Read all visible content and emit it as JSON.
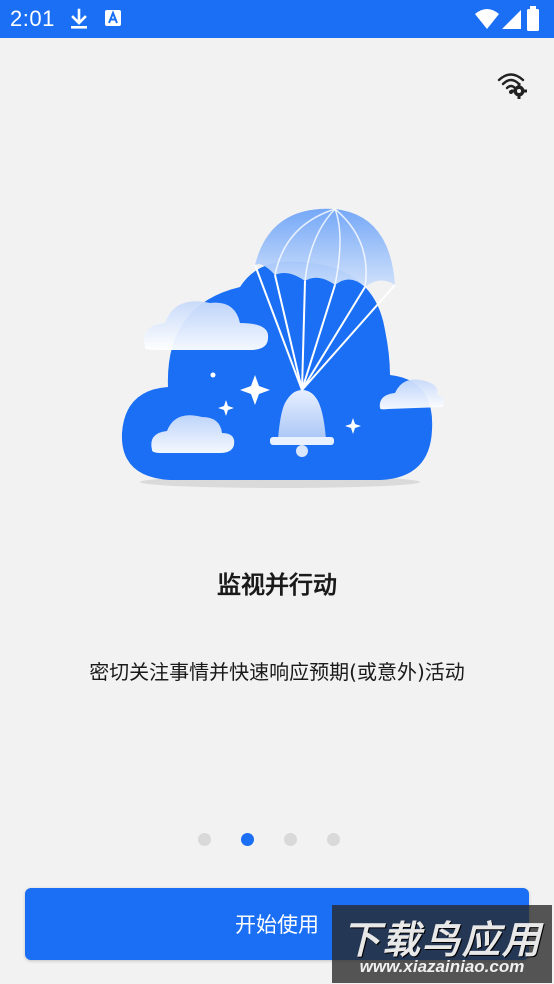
{
  "status_bar": {
    "time": "2:01",
    "icons": [
      "download-icon",
      "font-icon",
      "wifi-icon",
      "signal-icon",
      "battery-icon"
    ],
    "color": "#1a6ff5"
  },
  "toolbar": {
    "network_settings_icon": "wifi-settings-icon"
  },
  "onboarding": {
    "illustration": "cloud-parachute-bell-illustration",
    "title": "监视并行动",
    "description": "密切关注事情并快速响应预期(或意外)活动",
    "page_count": 4,
    "current_page": 2
  },
  "actions": {
    "start_label": "开始使用"
  },
  "watermark": {
    "title": "下载鸟应用",
    "url": "www.xiazainiao.com"
  },
  "colors": {
    "accent": "#1a6ff5",
    "background": "#f2f2f2",
    "dot_inactive": "#d9d9d9"
  }
}
